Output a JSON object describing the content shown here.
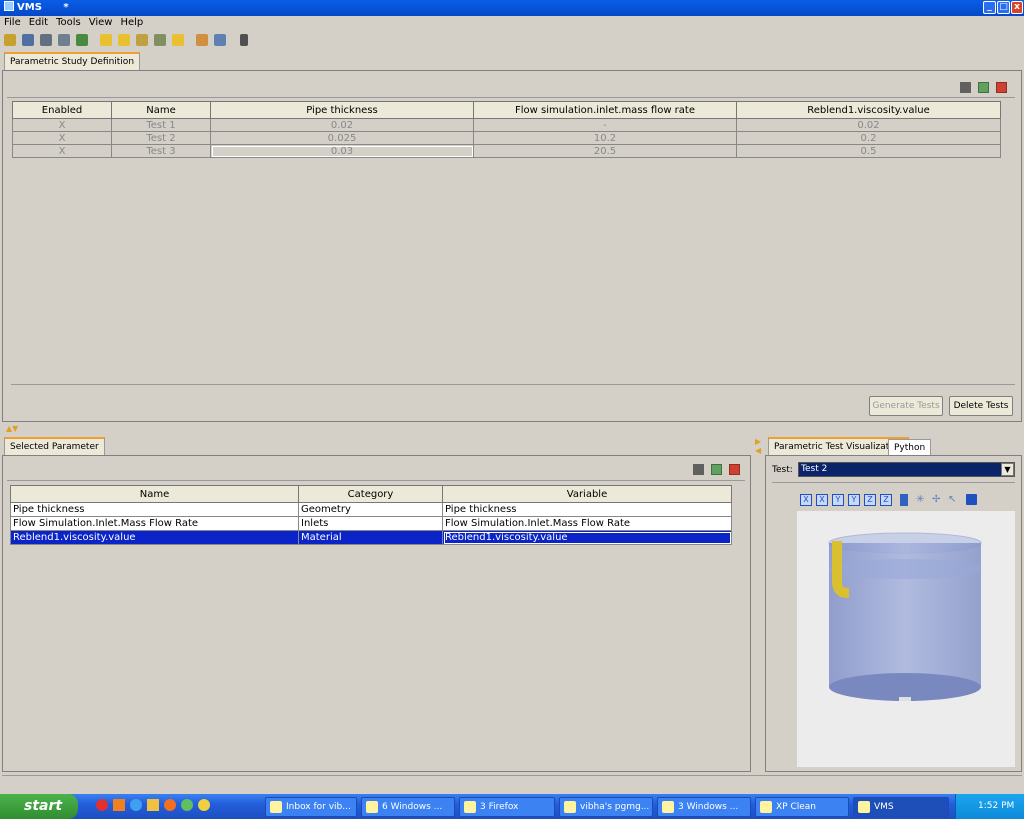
{
  "window": {
    "title": "VMS",
    "extra": "*"
  },
  "menu": [
    "File",
    "Edit",
    "Tools",
    "View",
    "Help"
  ],
  "top_panel": {
    "tab": "Parametric Study Definition",
    "columns": [
      "Enabled",
      "Name",
      "Pipe thickness",
      "Flow simulation.inlet.mass flow rate",
      "Reblend1.viscosity.value"
    ],
    "rows": [
      [
        "X",
        "Test 1",
        "0.02",
        "-",
        "0.02"
      ],
      [
        "X",
        "Test 2",
        "0.025",
        "10.2",
        "0.2"
      ],
      [
        "X",
        "Test 3",
        "0.03",
        "20.5",
        "0.5"
      ]
    ],
    "generate_label": "Generate Tests",
    "delete_label": "Delete Tests"
  },
  "bottom_panel": {
    "tab": "Selected Parameter",
    "columns": [
      "Name",
      "Category",
      "Variable"
    ],
    "rows": [
      [
        "Pipe thickness",
        "Geometry",
        "Pipe thickness"
      ],
      [
        "Flow Simulation.Inlet.Mass Flow Rate",
        "Inlets",
        "Flow Simulation.Inlet.Mass Flow Rate"
      ],
      [
        "Reblend1.viscosity.value",
        "Material",
        "Reblend1.viscosity.value"
      ]
    ]
  },
  "viz_panel": {
    "tabs": [
      "Parametric Test Visualization",
      "Python"
    ],
    "test_label": "Test:",
    "test_value": "Test 2",
    "axis_buttons": [
      "X",
      "X",
      "Y",
      "Y",
      "Z",
      "Z"
    ]
  },
  "taskbar": {
    "start": "start",
    "tasks": [
      "Inbox for vib...",
      "6 Windows ...",
      "3 Firefox",
      "vibha's pgmg...",
      "3 Windows ...",
      "XP Clean",
      "VMS"
    ],
    "clock": "1:52 PM"
  }
}
